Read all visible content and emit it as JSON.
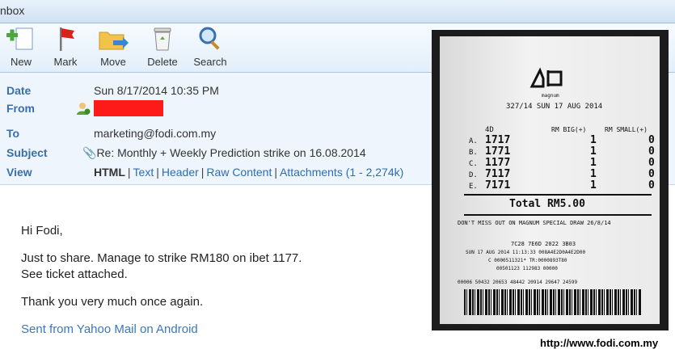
{
  "window": {
    "title": "nbox"
  },
  "toolbar": {
    "buttons": [
      {
        "label": "New",
        "icon": "new-icon"
      },
      {
        "label": "Mark",
        "icon": "flag-icon"
      },
      {
        "label": "Move",
        "icon": "folder-move-icon"
      },
      {
        "label": "Delete",
        "icon": "trash-icon"
      },
      {
        "label": "Search",
        "icon": "magnifier-icon"
      }
    ]
  },
  "email": {
    "date_label": "Date",
    "date_value": "Sun 8/17/2014 10:35 PM",
    "from_label": "From",
    "to_label": "To",
    "to_value": "marketing@fodi.com.my",
    "subject_label": "Subject",
    "subject_value": "Re: Monthly + Weekly Prediction strike on 16.08.2014",
    "view_label": "View",
    "view_options": [
      "HTML",
      "Text",
      "Header",
      "Raw Content",
      "Attachments (1 - 2,274k)"
    ]
  },
  "message": {
    "greeting": "Hi Fodi,",
    "line1": "Just to share. Manage to strike RM180 on ibet 1177.",
    "line2": "See ticket attached.",
    "line3": "Thank you very much once again.",
    "signature": "Sent from Yahoo Mail on Android"
  },
  "ticket": {
    "brand": "magnum",
    "draw_line": "327/14 SUN 17 AUG 2014",
    "col_4d": "4D",
    "col_big": "RM BIG(+)",
    "col_small": "RM SMALL(+)",
    "rows": [
      {
        "label": "A.",
        "number": "1717",
        "big": "1",
        "small": "0"
      },
      {
        "label": "B.",
        "number": "1771",
        "big": "1",
        "small": "0"
      },
      {
        "label": "C.",
        "number": "1177",
        "big": "1",
        "small": "0"
      },
      {
        "label": "D.",
        "number": "7117",
        "big": "1",
        "small": "0"
      },
      {
        "label": "E.",
        "number": "7171",
        "big": "1",
        "small": "0"
      }
    ],
    "total": "Total RM5.00",
    "promo": "DON'T MISS OUT ON MAGNUM SPECIAL DRAW 26/8/14",
    "code1": "7C28 7E6D 2022 3B03",
    "code2": "SUN 17 AUG 2014 11:13:33 008A4E2D0A4E2D00",
    "code3": "C 0000511321* TR:0000893T80",
    "code4": "00501123 112983 00000",
    "barcode_digits": "00006 50432 20653 48442 20914 29647 24599"
  },
  "footer": {
    "url": "http://www.fodi.com.my"
  },
  "colors": {
    "accent": "#3b6eaa",
    "redaction": "#ff1a1a"
  }
}
